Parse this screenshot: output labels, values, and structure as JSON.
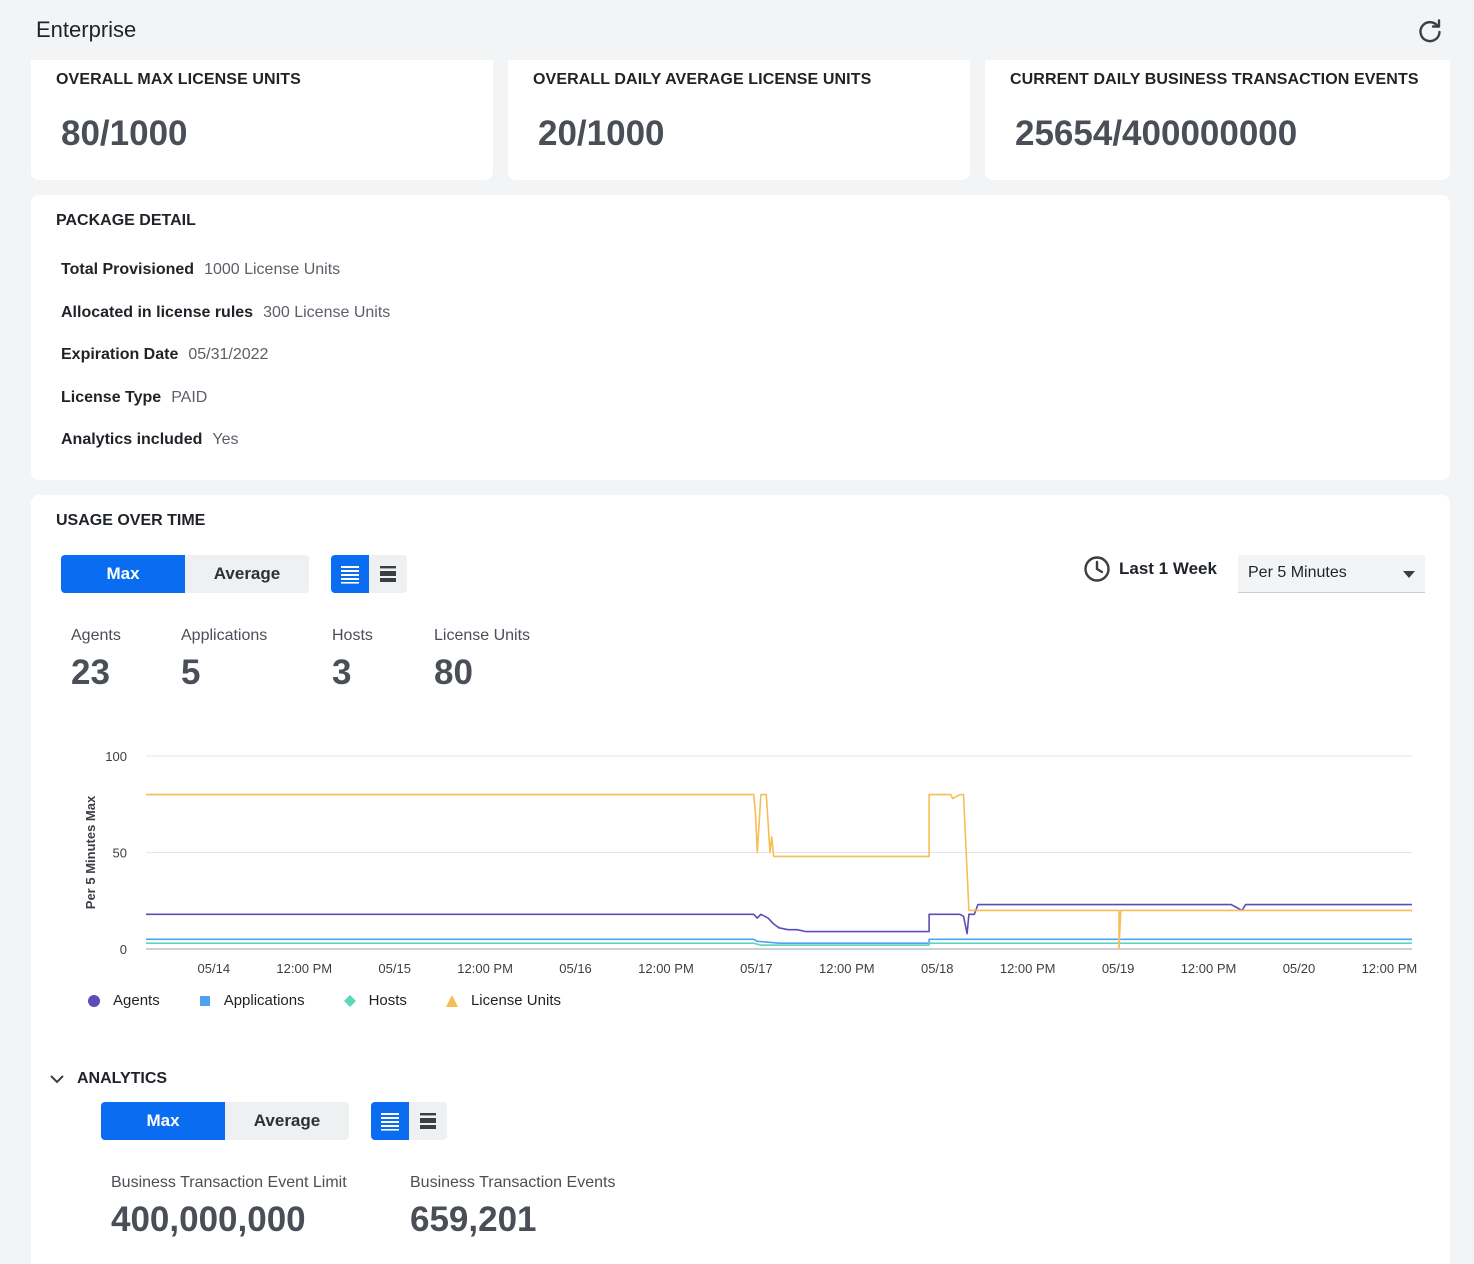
{
  "header": {
    "title": "Enterprise",
    "refresh_icon": "refresh-icon"
  },
  "kpis": [
    {
      "title": "OVERALL MAX LICENSE UNITS",
      "value": "80/1000"
    },
    {
      "title": "OVERALL DAILY AVERAGE LICENSE UNITS",
      "value": "20/1000"
    },
    {
      "title": "CURRENT DAILY BUSINESS TRANSACTION EVENTS",
      "value": "25654/400000000"
    }
  ],
  "package": {
    "title": "PACKAGE DETAIL",
    "rows": [
      {
        "label": "Total Provisioned",
        "value": "1000 License Units"
      },
      {
        "label": "Allocated in license rules",
        "value": "300 License Units"
      },
      {
        "label": "Expiration Date",
        "value": "05/31/2022"
      },
      {
        "label": "License Type",
        "value": "PAID"
      },
      {
        "label": "Analytics included",
        "value": "Yes"
      }
    ]
  },
  "usage": {
    "title": "USAGE OVER TIME",
    "toggle": {
      "max": "Max",
      "average": "Average",
      "selected": "Max"
    },
    "time_range": "Last 1 Week",
    "granularity": "Per 5 Minutes",
    "stats": [
      {
        "label": "Agents",
        "value": "23"
      },
      {
        "label": "Applications",
        "value": "5"
      },
      {
        "label": "Hosts",
        "value": "3"
      },
      {
        "label": "License Units",
        "value": "80"
      }
    ]
  },
  "chart_data": {
    "type": "line",
    "ylabel": "Per 5 Minutes Max",
    "ylim": [
      0,
      100
    ],
    "y_ticks": [
      0,
      50,
      100
    ],
    "x_tick_labels": [
      "05/14",
      "12:00 PM",
      "05/15",
      "12:00 PM",
      "05/16",
      "12:00 PM",
      "05/17",
      "12:00 PM",
      "05/18",
      "12:00 PM",
      "05/19",
      "12:00 PM",
      "05/20",
      "12:00 PM"
    ],
    "x_day_range": [
      0,
      7
    ],
    "grid": true,
    "legend_position": "bottom-left",
    "series": [
      {
        "name": "Agents",
        "color": "#5b4db7",
        "marker": "circle",
        "points": [
          [
            0,
            18
          ],
          [
            3.36,
            18
          ],
          [
            3.38,
            16
          ],
          [
            3.4,
            18
          ],
          [
            3.44,
            16
          ],
          [
            3.47,
            13
          ],
          [
            3.5,
            11
          ],
          [
            3.55,
            10
          ],
          [
            3.6,
            10
          ],
          [
            3.65,
            9
          ],
          [
            4.33,
            9
          ],
          [
            4.33,
            18
          ],
          [
            4.5,
            18
          ],
          [
            4.52,
            17
          ],
          [
            4.54,
            8
          ],
          [
            4.55,
            18
          ],
          [
            4.58,
            18
          ],
          [
            4.6,
            23
          ],
          [
            6.0,
            23
          ],
          [
            6.02,
            22
          ],
          [
            6.06,
            20
          ],
          [
            6.08,
            23
          ],
          [
            7,
            23
          ]
        ]
      },
      {
        "name": "Applications",
        "color": "#4da3f2",
        "marker": "square",
        "points": [
          [
            0,
            5
          ],
          [
            3.36,
            5
          ],
          [
            3.38,
            4
          ],
          [
            3.5,
            3
          ],
          [
            4.33,
            3
          ],
          [
            4.33,
            5
          ],
          [
            7,
            5
          ]
        ]
      },
      {
        "name": "Hosts",
        "color": "#5ed6b9",
        "marker": "diamond",
        "points": [
          [
            0,
            3
          ],
          [
            3.36,
            3
          ],
          [
            3.4,
            2
          ],
          [
            4.33,
            2
          ],
          [
            4.33,
            3
          ],
          [
            7,
            3
          ]
        ]
      },
      {
        "name": "License Units",
        "color": "#f7bd57",
        "marker": "triangle",
        "points": [
          [
            0,
            80
          ],
          [
            3.36,
            80
          ],
          [
            3.37,
            70
          ],
          [
            3.38,
            50
          ],
          [
            3.4,
            80
          ],
          [
            3.43,
            80
          ],
          [
            3.45,
            50
          ],
          [
            3.46,
            58
          ],
          [
            3.47,
            48
          ],
          [
            4.33,
            48
          ],
          [
            4.33,
            80
          ],
          [
            4.45,
            80
          ],
          [
            4.46,
            78
          ],
          [
            4.5,
            80
          ],
          [
            4.52,
            80
          ],
          [
            4.55,
            20
          ],
          [
            4.58,
            20
          ],
          [
            5.38,
            20
          ],
          [
            5.38,
            0
          ],
          [
            5.39,
            20
          ],
          [
            7,
            20
          ]
        ]
      }
    ]
  },
  "analytics": {
    "title": "ANALYTICS",
    "toggle": {
      "max": "Max",
      "average": "Average",
      "selected": "Max"
    },
    "stats": [
      {
        "label": "Business Transaction Event Limit",
        "value": "400,000,000"
      },
      {
        "label": "Business Transaction Events",
        "value": "659,201"
      }
    ]
  }
}
